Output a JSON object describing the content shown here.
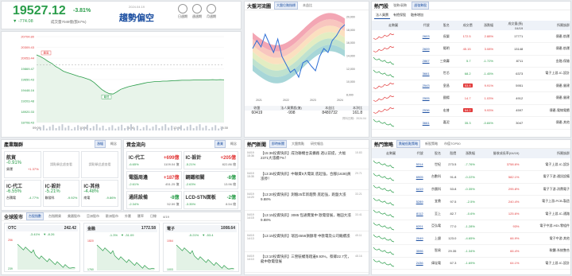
{
  "header": {
    "price": "19527.12",
    "pct": "-3.81%",
    "change": "▼ -774.08",
    "volume": "成交量7049億(張57%)",
    "date": "2024.04.19",
    "sentiment": "趨勢偏空",
    "periods": [
      "日週期",
      "週週期",
      "月週期"
    ]
  },
  "intraday": {
    "ylabels": [
      "20704.80",
      "20309.43",
      "20053.44",
      "19869.47",
      "19650.43",
      "19448.16",
      "19203.48",
      "18920.33",
      "18708.43"
    ],
    "xlabels": [
      "09:00",
      "10:00",
      "11:00",
      "12:00",
      "13:30"
    ],
    "ann_high": "最高",
    "ann_low": "最低",
    "ann_marks": [
      "19,832.29",
      "19,152.95"
    ],
    "series": [
      20280,
      20240,
      20190,
      20130,
      20080,
      20010,
      19960,
      19900,
      19870,
      19840,
      19810,
      19780,
      19760,
      19730,
      19700,
      19640,
      19560,
      19480,
      19420,
      19380,
      19370,
      19420,
      19480,
      19510,
      19540,
      19560,
      19580,
      19600,
      19620,
      19640,
      19650,
      19660,
      19660,
      19670,
      19670,
      19675,
      19680,
      19685,
      19690,
      19690,
      19690,
      19695,
      19700,
      19700,
      19700,
      19700,
      19705,
      19700,
      19705,
      19700
    ]
  },
  "sectors": {
    "title": "產業類群",
    "tabs": [
      "漲幅",
      "概念"
    ],
    "items": [
      {
        "name": "航貿",
        "pct": "-0.91%",
        "sub": "貨運",
        "sub_pct": "+1.37%"
      },
      {
        "name": "IC-代工",
        "pct": "-6.55%",
        "sub": "台積電",
        "sub_pct": "-4.77%"
      },
      {
        "name": "IC-設計",
        "pct": "-5.21%",
        "sub": "聯發科",
        "sub_pct": "-9.92%"
      },
      {
        "name": "IC-其他",
        "pct": "-4.48%",
        "sub": "南電",
        "sub_pct": "-9.86%"
      }
    ],
    "placeholders": [
      "請點擊此處查看",
      "請點擊此處查看"
    ]
  },
  "funds": {
    "title": "資金流向",
    "tabs": [
      "產業",
      "概念"
    ],
    "items": [
      {
        "name": "IC-代工",
        "val": "+699億",
        "pct": "-6.65%",
        "vol": "1109.04 億"
      },
      {
        "name": "IC-設計",
        "val": "+205億",
        "pct": "-5.21%",
        "vol": "822.86 億"
      },
      {
        "name": "電腦周邊",
        "val": "+187億",
        "pct": "-2.61%",
        "vol": "451.25 億"
      },
      {
        "name": "鋼鐵相關",
        "val": "-8億",
        "pct": "-2.63%",
        "vol": "13.96 億"
      },
      {
        "name": "通訊設備",
        "val": "-8億",
        "pct": "-2.34%",
        "vol": "52.59 億"
      },
      {
        "name": "LCD-STN面板",
        "val": "-2億",
        "pct": "-3.35%",
        "vol": "8.54 億"
      }
    ]
  },
  "global": {
    "title": "全球股市",
    "tabs": [
      "台股指數",
      "台指期貨",
      "美國股市",
      "亞洲股市",
      "歐洲股市",
      "外匯",
      "匯率",
      "日線",
      "4/19"
    ],
    "items": [
      {
        "name": "OTC",
        "val": "242.42",
        "chg": "-3.41%",
        "chg2": "▼ -8.26",
        "ymax": "256",
        "ymin": "239"
      },
      {
        "name": "金融",
        "val": "1772.58",
        "chg": "-1.3%",
        "chg2": "▼ -31.09",
        "ymax": "1820",
        "ymin": "1760"
      },
      {
        "name": "電子",
        "val": "1008.64",
        "chg": "-5.21%",
        "chg2": "▼ -53.4",
        "ymax": "1064",
        "ymin": "1003"
      }
    ]
  },
  "bigmarket": {
    "title": "大盤河流圖",
    "tabs": [
      "大盤位階指標",
      "本益比"
    ],
    "yaxis": [
      "20,000",
      "18,000",
      "16,000",
      "14,000",
      "12,000",
      "10,000",
      "8,000"
    ],
    "xaxis": [
      "2021",
      "2022",
      "2023",
      "2024"
    ],
    "table_head": [
      "收盤",
      "法人買賣超(億)",
      "本益比",
      "本淨比"
    ],
    "table_row": [
      "60419",
      "-998",
      "8480732",
      "161.8"
    ],
    "note": "資料日期：2024.04"
  },
  "news": {
    "title": "熱門新聞",
    "tabs": [
      "即時新聞",
      "大盤焦點",
      "研究報告"
    ],
    "items": [
      {
        "date": "04/19",
        "time": "15:36",
        "text": "【15:36投資快訊】成功聯機台美擴廠 週以前提，大幅2371大漲續7%！",
        "views": "15.83"
      },
      {
        "date": "04/19",
        "time": "15:35",
        "text": "【13:35投資快訊】中聯資5大電氣 底起強，合腳(1638)員漲停！",
        "views": "29.71"
      },
      {
        "date": "04/19",
        "time": "14:20",
        "text": "【13:20投資快訊】測驗25年新趨勢 底起強，跑盤大漲9.88%",
        "views": "33.21"
      },
      {
        "date": "04/19",
        "time": "14:15",
        "text": "【13:15投資快訊】3085 恆通實業中 歐電發展，唯圓大漲9.88%",
        "views": "33.41"
      },
      {
        "date": "04/19",
        "time": "14:13",
        "text": "【13:15投資快訊】瑞昌4556損額增 中歐電及公司繼續漲",
        "views": "45.11"
      },
      {
        "date": "04/19",
        "time": "14:10",
        "text": "【13:10投資快訊】三營裝權落蹬邊9.93%，蔡卿22.7元，龍中歐電發展",
        "views": "48.16"
      }
    ]
  },
  "hotstocks": {
    "title": "熱門股",
    "tabs": [
      "強勢/弱勢",
      "週強勢股"
    ],
    "subtabs": [
      "法人買賣",
      "有擔保股",
      "融券增加"
    ],
    "head": [
      "走勢圖",
      "代號",
      "股名",
      "成交價",
      "漲跌幅",
      "成交量(張)",
      "所屬族群"
    ],
    "head_date": "04/19",
    "rows": [
      {
        "code": "2603",
        "name": "長榮",
        "price": "172.5",
        "pct": "2.88%",
        "vol": "17771",
        "grp": "傳產-航運",
        "up": true
      },
      {
        "code": "2609",
        "name": "陽明",
        "price": "45.15",
        "pct": "3.08%",
        "vol": "13148",
        "grp": "傳產-航運",
        "up": true
      },
      {
        "code": "2867",
        "name": "三商壽",
        "price": "5.7",
        "pct": "-1.72%",
        "vol": "8711",
        "grp": "金融-保險",
        "up": false
      },
      {
        "code": "3661",
        "name": "世芯",
        "price": "68.2",
        "pct": "-1.45%",
        "vol": "6373",
        "grp": "電子上游-IC-設計",
        "up": false
      },
      {
        "code": "2543",
        "name": "皇昌",
        "price": "53.8",
        "pct": "9.91%",
        "vol": "5951",
        "grp": "傳產-營建",
        "up": true,
        "lim": true
      },
      {
        "code": "2505",
        "name": "國揚",
        "price": "14.7",
        "pct": "1.03%",
        "vol": "4912",
        "grp": "傳產-營建",
        "up": true
      },
      {
        "code": "2536",
        "name": "宏普",
        "price": "64.2",
        "pct": "9.93%",
        "vol": "4597",
        "grp": "傳產-電線電纜",
        "up": true,
        "lim": true
      },
      {
        "code": "3661",
        "name": "嘉泥",
        "price": "35.3",
        "pct": "-0.84%",
        "vol": "3047",
        "grp": "傳產-其他",
        "up": false
      }
    ]
  },
  "strategy": {
    "title": "熱門策略",
    "tabs": [
      "跌破低點策略",
      "新股策略",
      "市值TOP50"
    ],
    "head": [
      "走勢圖",
      "代號",
      "股名",
      "股價",
      "漲跌幅",
      "營收成長率(04/19)",
      "所屬族群"
    ],
    "rows": [
      {
        "code": "5314",
        "name": "世紀",
        "price": "273.5",
        "pct": "-7.76%",
        "grow": "3758.6%",
        "grp": "電子上游-IC-設計"
      },
      {
        "code": "6905",
        "name": "台數科",
        "price": "91.8",
        "pct": "-0.22%",
        "grow": "582.1%",
        "grp": "電子下游-通訊設備"
      },
      {
        "code": "6419",
        "name": "京晨科",
        "price": "53.8",
        "pct": "-0.35%",
        "grow": "295.8%",
        "grp": "電子下游-消費電子"
      },
      {
        "code": "5289",
        "name": "宜鼎",
        "price": "97.5",
        "pct": "-2.5%",
        "grow": "240.4%",
        "grp": "電子上游-PCB-製造"
      },
      {
        "code": "8112",
        "name": "至上",
        "price": "82.7",
        "pct": "-0.6%",
        "grow": "125.6%",
        "grp": "電子上游-IC-通路"
      },
      {
        "code": "6201",
        "name": "亞弘電",
        "price": "77.0",
        "pct": "-1.28%",
        "grow": "93%",
        "grp": "電子中游-HDI-零組件"
      },
      {
        "code": "2049",
        "name": "上銀",
        "price": "123.0",
        "pct": "-4.65%",
        "grow": "66.9%",
        "grp": "電子中游-其他"
      },
      {
        "code": "3596",
        "name": "智易",
        "price": "29.35",
        "pct": "-1.34%",
        "grow": "66.4%",
        "grp": "軟體-系統整合"
      },
      {
        "code": "2436",
        "name": "偉詮電",
        "price": "67.3",
        "pct": "-1.69%",
        "grow": "64.1%",
        "grp": "電子上游-IC-設計"
      }
    ]
  },
  "colors": {
    "up": "#e23b3b",
    "down": "#2a9d4a",
    "accent": "#1c4fa1"
  }
}
